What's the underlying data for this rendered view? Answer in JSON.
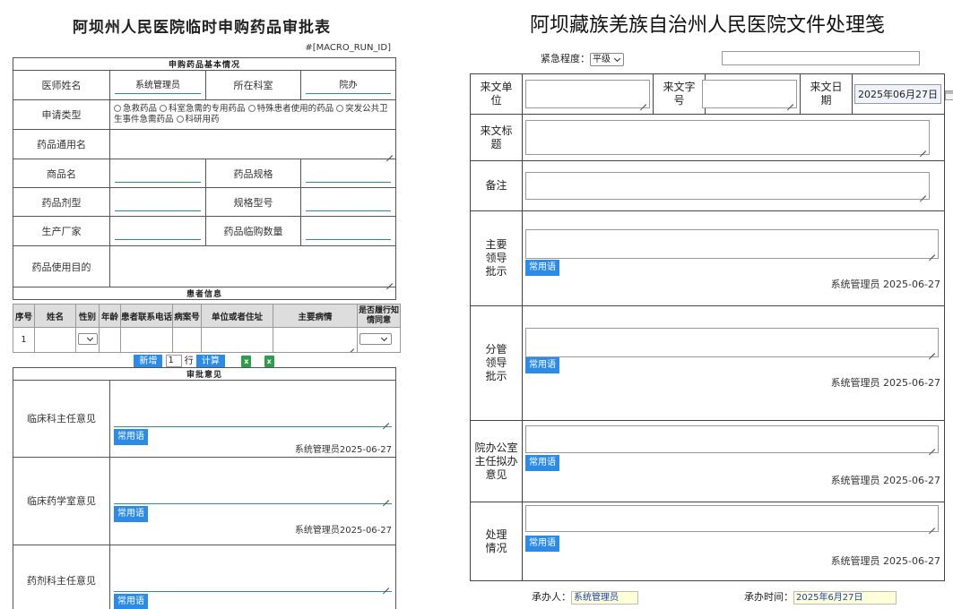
{
  "left": {
    "title": "阿坝州人民医院临时申购药品审批表",
    "macro": "#[MACRO_RUN_ID]",
    "section_basic": "申购药品基本情况",
    "doctor_label": "医师姓名",
    "doctor_value": "系统管理员",
    "dept_label": "所在科室",
    "dept_value": "院办",
    "apply_type_label": "申请类型",
    "apply_options": [
      "急救药品",
      "科室急需的专用药品",
      "特殊患者使用的药品",
      "突发公共卫生事件急需药品",
      "科研用药"
    ],
    "generic_name_label": "药品通用名",
    "trade_name_label": "商品名",
    "spec_label": "药品规格",
    "form_label": "药品剂型",
    "model_label": "规格型号",
    "maker_label": "生产厂家",
    "qty_label": "药品临购数量",
    "purpose_label": "药品使用目的",
    "section_patient": "患者信息",
    "patient_headers": [
      "序号",
      "姓名",
      "性别",
      "年龄",
      "患者联系电话",
      "病案号",
      "单位或者住址",
      "主要病情",
      "是否履行知情同意"
    ],
    "patient_row_index": "1",
    "add_button": "新增",
    "row_count": "1",
    "row_unit": "行",
    "calc_button": "计算",
    "section_approval": "审批意见",
    "approvals": [
      {
        "label": "临床科主任意见",
        "phrase": "常用语",
        "sign": "系统管理员2025-06-27"
      },
      {
        "label": "临床药学室意见",
        "phrase": "常用语",
        "sign": "系统管理员2025-06-27"
      },
      {
        "label": "药剂科主任意见",
        "phrase": "常用语",
        "sign": ""
      }
    ]
  },
  "right": {
    "title": "阿坝藏族羌族自治州人民医院文件处理笺",
    "urgency_label": "紧急程度：",
    "urgency_value": "平级",
    "src_unit_label": "来文单位",
    "src_no_label": "来文字号",
    "src_date_label": "来文日期",
    "src_date_value": "2025年06月27日",
    "src_title_label": "来文标题",
    "remark_label": "备注",
    "sections": [
      {
        "label": "主要领导批示",
        "phrase": "常用语",
        "sign": "系统管理员 2025-06-27"
      },
      {
        "label": "分管领导批示",
        "phrase": "常用语",
        "sign": "系统管理员 2025-06-27"
      },
      {
        "label": "院办公室主任拟办意见",
        "phrase": "常用语",
        "sign": "系统管理员 2025-06-27"
      },
      {
        "label": "处理情况",
        "phrase": "常用语",
        "sign": "系统管理员 2025-06-27"
      }
    ],
    "handler_label": "承办人：",
    "handler_value": "系统管理员",
    "handle_time_label": "承办时间：",
    "handle_time_value": "2025年6月27日"
  }
}
